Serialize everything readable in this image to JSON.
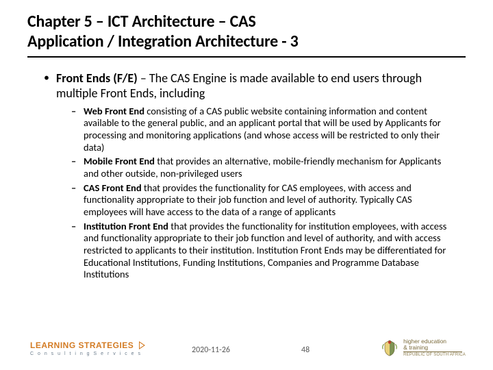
{
  "title_line1": "Chapter 5 – ICT Architecture – CAS",
  "title_line2": "Application / Integration Architecture - 3",
  "bullet1_bold": "Front Ends (F/E)",
  "bullet1_rest": " – The CAS Engine is made available to end users through multiple Front Ends, including",
  "sub": [
    {
      "bold": "Web Front End",
      "rest": " consisting of a CAS public website containing information and content available to the general public, and an applicant portal that will be used by Applicants for processing and monitoring applications (and whose access will be restricted to only their data)"
    },
    {
      "bold": "Mobile Front End",
      "rest": " that provides an alternative, mobile-friendly mechanism for Applicants and other outside, non-privileged users"
    },
    {
      "bold": "CAS Front End",
      "rest": " that provides the functionality for CAS employees, with access and functionality appropriate to their job function and level of authority.  Typically CAS employees will have access to the data of a range of applicants"
    },
    {
      "bold": "Institution Front End",
      "rest": " that provides the functionality for institution employees, with access and functionality appropriate to their job function and level of authority, and with access restricted to applicants to their institution. Institution Front Ends may be differentiated for Educational Institutions, Funding Institutions, Companies and Programme Database Institutions"
    }
  ],
  "footer": {
    "date": "2020-11-26",
    "page": "48"
  },
  "logo_left": {
    "top": "LEARNING STRATEGIES",
    "sub": "C o n s u l t i n g   S e r v i c e s"
  },
  "logo_right": {
    "row1": "higher education",
    "row2": "& training",
    "row3": "REPUBLIC OF SOUTH AFRICA"
  }
}
